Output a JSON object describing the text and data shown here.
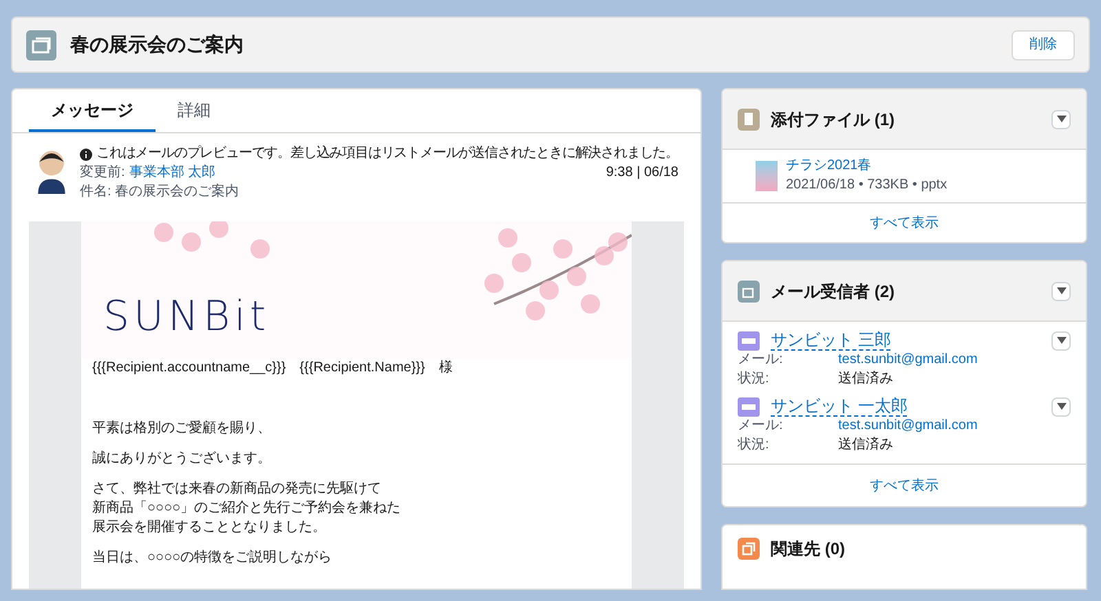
{
  "header": {
    "title": "春の展示会のご案内",
    "delete_button": "削除"
  },
  "tabs": [
    {
      "label": "メッセージ",
      "selected": true
    },
    {
      "label": "詳細",
      "selected": false
    }
  ],
  "message": {
    "notice": "これはメールのプレビューです。差し込み項目はリストメールが送信されたときに解決されました。",
    "from_label": "変更前:",
    "from_name": "事業本部 太郎",
    "time": "9:38 | 06/18",
    "subject": "件名: 春の展示会のご案内"
  },
  "email": {
    "logo": "SUNBit",
    "salutation": "{{{Recipient.accountname__c}}}　{{{Recipient.Name}}}　様",
    "paragraphs": [
      [
        "平素は格別のご愛顧を賜り、"
      ],
      [
        "誠にありがとうございます。"
      ],
      [
        "さて、弊社では来春の新商品の発売に先駆けて",
        "新商品「○○○○」のご紹介と先行ご予約会を兼ねた",
        "展示会を開催することとなりました。"
      ],
      [
        "当日は、○○○○の特徴をご説明しながら"
      ]
    ]
  },
  "attachments": {
    "title": "添付ファイル (1)",
    "files": [
      {
        "name": "チラシ2021春",
        "meta": "2021/06/18 • 733KB • pptx"
      }
    ],
    "view_all": "すべて表示"
  },
  "recipients": {
    "title": "メール受信者 (2)",
    "items": [
      {
        "name": "サンビット 三郎",
        "email_label": "メール:",
        "email": "test.sunbit@gmail.com",
        "status_label": "状況:",
        "status": "送信済み"
      },
      {
        "name": "サンビット 一太郎",
        "email_label": "メール:",
        "email": "test.sunbit@gmail.com",
        "status_label": "状況:",
        "status": "送信済み"
      }
    ],
    "view_all": "すべて表示"
  },
  "related": {
    "title": "関連先 (0)"
  }
}
